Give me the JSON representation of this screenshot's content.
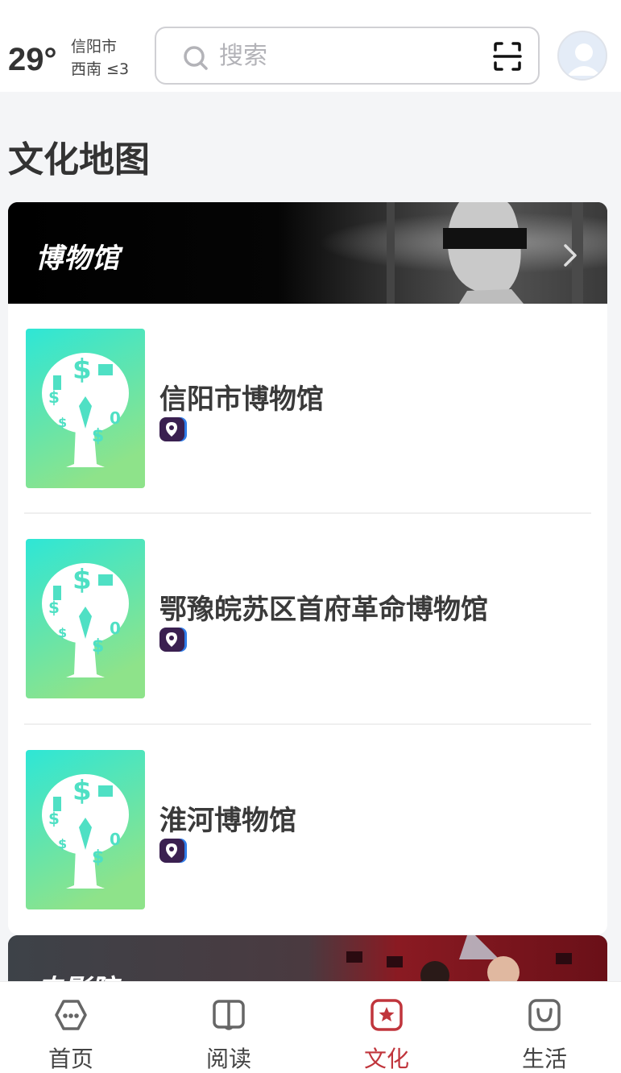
{
  "header": {
    "temperature": "29°",
    "city": "信阳市",
    "wind": "西南 ≤3",
    "search_placeholder": "搜索",
    "search_icon": "search-icon",
    "scan_icon": "scan-icon",
    "avatar_icon": "user-avatar-icon"
  },
  "page_title": "文化地图",
  "section": {
    "title": "博物馆",
    "items": [
      {
        "name": "信阳市博物馆"
      },
      {
        "name": "鄂豫皖苏区首府革命博物馆"
      },
      {
        "name": "淮河博物馆"
      }
    ]
  },
  "next_section": {
    "title": "电影院"
  },
  "colors": {
    "accent": "#c0353c",
    "thumb_gradient_top": "#2ee6d6",
    "thumb_gradient_bottom": "#8ee38a",
    "badge": "#3a2050"
  },
  "nav": {
    "items": [
      {
        "label": "首页",
        "icon": "home-icon"
      },
      {
        "label": "阅读",
        "icon": "book-icon"
      },
      {
        "label": "文化",
        "icon": "culture-star-icon",
        "active": true
      },
      {
        "label": "生活",
        "icon": "life-bag-icon"
      }
    ]
  }
}
